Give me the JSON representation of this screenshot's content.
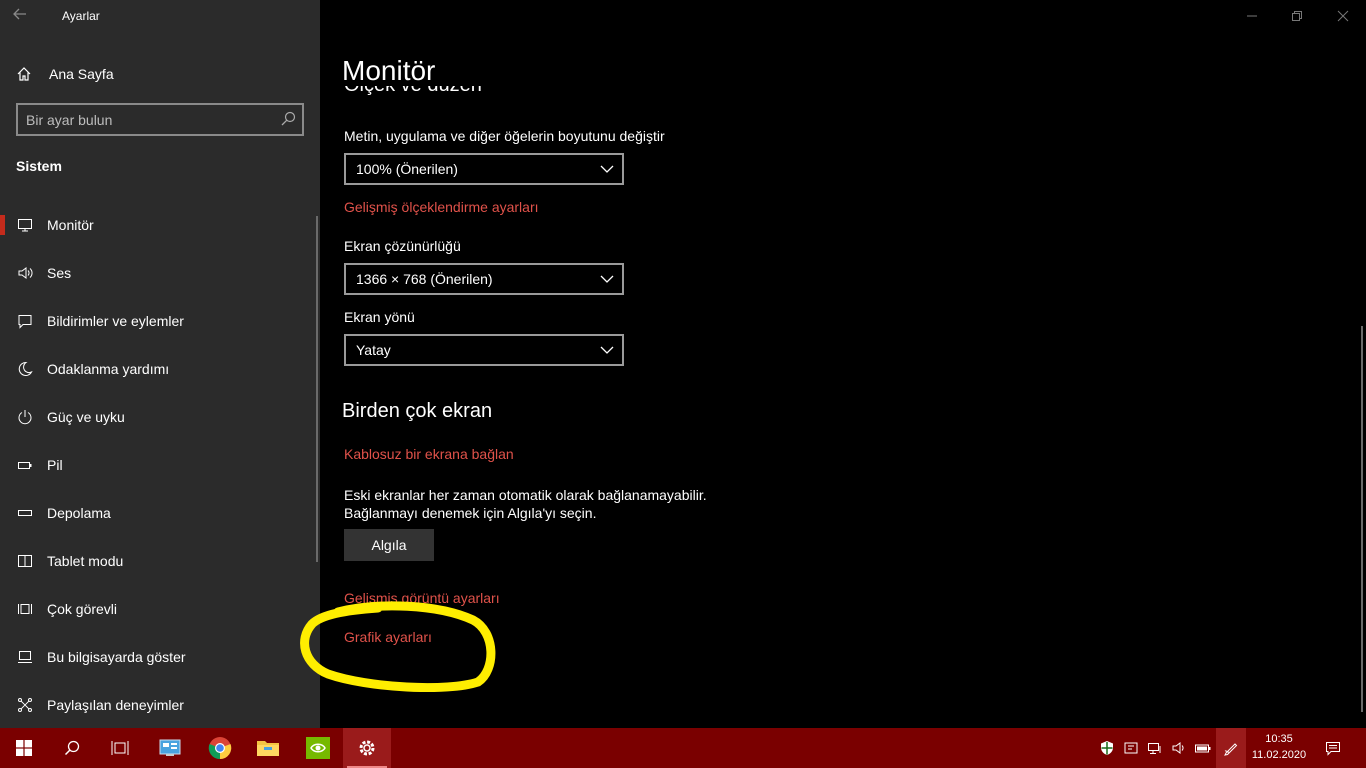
{
  "window": {
    "title": "Ayarlar",
    "controls": [
      "minimize-icon",
      "restore-icon",
      "close-icon"
    ]
  },
  "sidebar": {
    "home_label": "Ana Sayfa",
    "search_placeholder": "Bir ayar bulun",
    "section_label": "Sistem",
    "items": [
      {
        "label": "Monitör",
        "icon": "monitor-icon",
        "active": true
      },
      {
        "label": "Ses",
        "icon": "speaker-icon"
      },
      {
        "label": "Bildirimler ve eylemler",
        "icon": "notification-icon"
      },
      {
        "label": "Odaklanma yardımı",
        "icon": "moon-icon"
      },
      {
        "label": "Güç ve uyku",
        "icon": "power-icon"
      },
      {
        "label": "Pil",
        "icon": "battery-icon"
      },
      {
        "label": "Depolama",
        "icon": "storage-icon"
      },
      {
        "label": "Tablet modu",
        "icon": "tablet-icon"
      },
      {
        "label": "Çok görevli",
        "icon": "multitask-icon"
      },
      {
        "label": "Bu bilgisayarda göster",
        "icon": "project-icon"
      },
      {
        "label": "Paylaşılan deneyimler",
        "icon": "shared-icon"
      }
    ]
  },
  "main": {
    "page_title": "Monitör",
    "partial_heading": "Ölçek ve düzen",
    "scale_label": "Metin, uygulama ve diğer öğelerin boyutunu değiştir",
    "scale_value": "100% (Önerilen)",
    "advanced_scaling_link": "Gelişmiş ölçeklendirme ayarları",
    "resolution_label": "Ekran çözünürlüğü",
    "resolution_value": "1366 × 768 (Önerilen)",
    "orientation_label": "Ekran yönü",
    "orientation_value": "Yatay",
    "multi_display_heading": "Birden çok ekran",
    "wireless_link": "Kablosuz bir ekrana bağlan",
    "detect_text": "Eski ekranlar her zaman otomatik olarak bağlanamayabilir. Bağlanmayı denemek için Algıla'yı seçin.",
    "detect_button": "Algıla",
    "advanced_display_link": "Gelişmiş görüntü ayarları",
    "graphics_link": "Grafik ayarları"
  },
  "colors": {
    "accent_link": "#e0524a",
    "active_indicator": "#c42b1c",
    "taskbar": "#7a0000",
    "highlight_annotation": "#ffee00"
  },
  "taskbar": {
    "apps": [
      "windows-start-icon",
      "search-icon",
      "task-view-icon",
      "control-panel-icon",
      "chrome-icon",
      "file-explorer-icon",
      "nvidia-icon",
      "settings-gear-icon"
    ],
    "tray": [
      "security-shield-icon",
      "device-icon",
      "network-icon",
      "volume-icon",
      "battery-icon",
      "pen-icon",
      "action-center-icon"
    ],
    "time": "10:35",
    "date": "11.02.2020"
  }
}
